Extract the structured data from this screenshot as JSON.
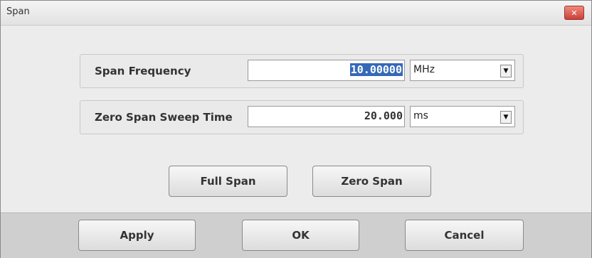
{
  "window": {
    "title": "Span",
    "close_icon": "close-icon"
  },
  "span_frequency": {
    "label": "Span Frequency",
    "value": "10.00000",
    "unit": "MHz"
  },
  "sweep_time": {
    "label": "Zero Span Sweep Time",
    "value": "20.000",
    "unit": "ms"
  },
  "buttons": {
    "full_span": "Full Span",
    "zero_span": "Zero Span"
  },
  "footer": {
    "apply": "Apply",
    "ok": "OK",
    "cancel": "Cancel"
  }
}
